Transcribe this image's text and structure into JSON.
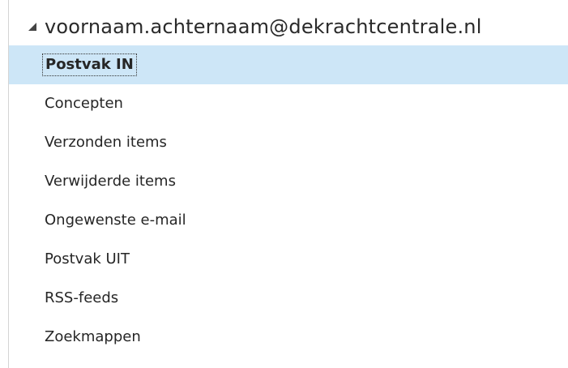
{
  "account": {
    "email": "voornaam.achternaam@dekrachtcentrale.nl",
    "expanded": true,
    "arrow_icon": "collapse-triangle-icon"
  },
  "folders": [
    {
      "label": "Postvak IN",
      "selected": true
    },
    {
      "label": "Concepten",
      "selected": false
    },
    {
      "label": "Verzonden items",
      "selected": false
    },
    {
      "label": "Verwijderde items",
      "selected": false
    },
    {
      "label": "Ongewenste e-mail",
      "selected": false
    },
    {
      "label": "Postvak UIT",
      "selected": false
    },
    {
      "label": "RSS-feeds",
      "selected": false
    },
    {
      "label": "Zoekmappen",
      "selected": false
    }
  ],
  "colors": {
    "selection_background": "#cde6f7",
    "text": "#262626",
    "border": "#d4d4d4"
  }
}
